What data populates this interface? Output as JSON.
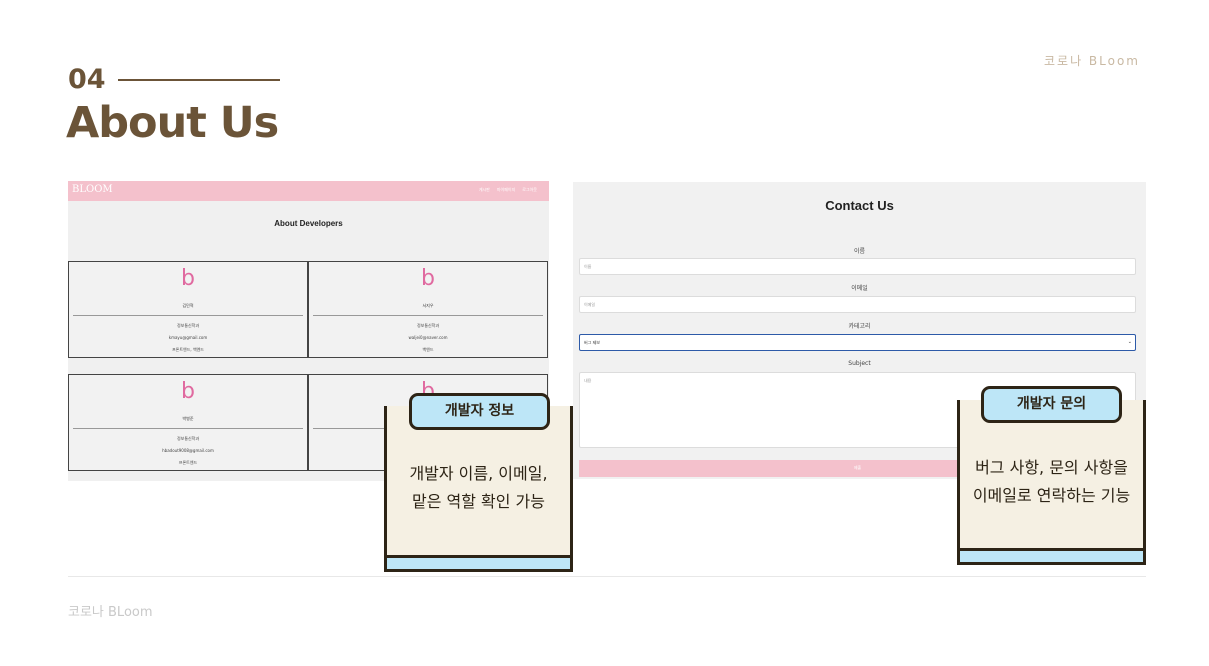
{
  "brand_top": "코로나 BLoom",
  "section": {
    "number": "04",
    "title": "About Us"
  },
  "left_shot": {
    "logo": "BLOOM",
    "nav": [
      "게시판",
      "마이페이지",
      "로그아웃"
    ],
    "heading": "About Developers",
    "logo_glyph": "b",
    "developers": [
      {
        "name": "김민혁",
        "lines": [
          "정보통신학과",
          "kmayu@gmail.com",
          "프론트엔드, 백엔드"
        ]
      },
      {
        "name": "서지우",
        "lines": [
          "정보통신학과",
          "waljei0@naver.com",
          "백엔드"
        ]
      },
      {
        "name": "박병준",
        "lines": [
          "정보통신학과",
          "hbadout9008@gmail.com",
          "프론트엔드"
        ]
      },
      {
        "name": "",
        "lines": [
          "",
          "",
          ""
        ]
      }
    ]
  },
  "right_shot": {
    "heading": "Contact Us",
    "name_label": "이름",
    "name_placeholder": "이름",
    "email_label": "이메일",
    "email_placeholder": "이메일",
    "category_label": "카테고리",
    "category_value": "버그 제보",
    "subject_label": "Subject",
    "subject_placeholder": "내용",
    "submit_label": "제출"
  },
  "callout_left": {
    "tab": "개발자 정보",
    "lines": [
      "개발자 이름, 이메일,",
      "맡은 역할 확인 가능"
    ]
  },
  "callout_right": {
    "tab": "개발자 문의",
    "lines": [
      "버그 사항, 문의 사항을",
      "이메일로 연락하는 기능"
    ]
  },
  "footer": {
    "brand": "코로나 BLoom"
  }
}
